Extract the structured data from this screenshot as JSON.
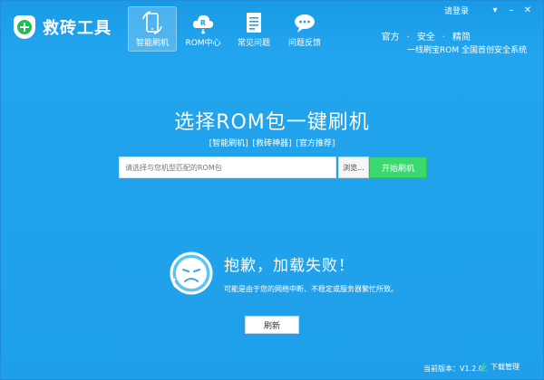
{
  "app": {
    "title": "救砖工具"
  },
  "nav": {
    "items": [
      {
        "label": "智能刷机",
        "icon": "smart-flash-icon",
        "active": true
      },
      {
        "label": "ROM中心",
        "icon": "rom-cloud-icon",
        "active": false
      },
      {
        "label": "常见问题",
        "icon": "faq-document-icon",
        "active": false
      },
      {
        "label": "问题反馈",
        "icon": "feedback-chat-icon",
        "active": false
      }
    ]
  },
  "top": {
    "login": "请登录",
    "links": [
      "官方",
      "·",
      "安全",
      "·",
      "精简"
    ],
    "slogan": "一线刷宝ROM  全国首创安全系统"
  },
  "main": {
    "title": "选择ROM包一键刷机",
    "tags": [
      "[智能刷机]",
      "[救砖神器]",
      "[官方推荐]"
    ],
    "input_placeholder": "请选择与您机型匹配的ROM包",
    "browse_label": "浏览...",
    "start_label": "开始刷机"
  },
  "error": {
    "title": "抱歉，加载失败！",
    "desc": "可能是由于您的网络中断、不稳定或服务器繁忙所致。",
    "refresh_label": "刷新"
  },
  "footer": {
    "version": "当前版本：V1.2.0",
    "download": "下载管理"
  },
  "colors": {
    "background": "#1f9fe9",
    "accent_green": "#3ad86f"
  }
}
